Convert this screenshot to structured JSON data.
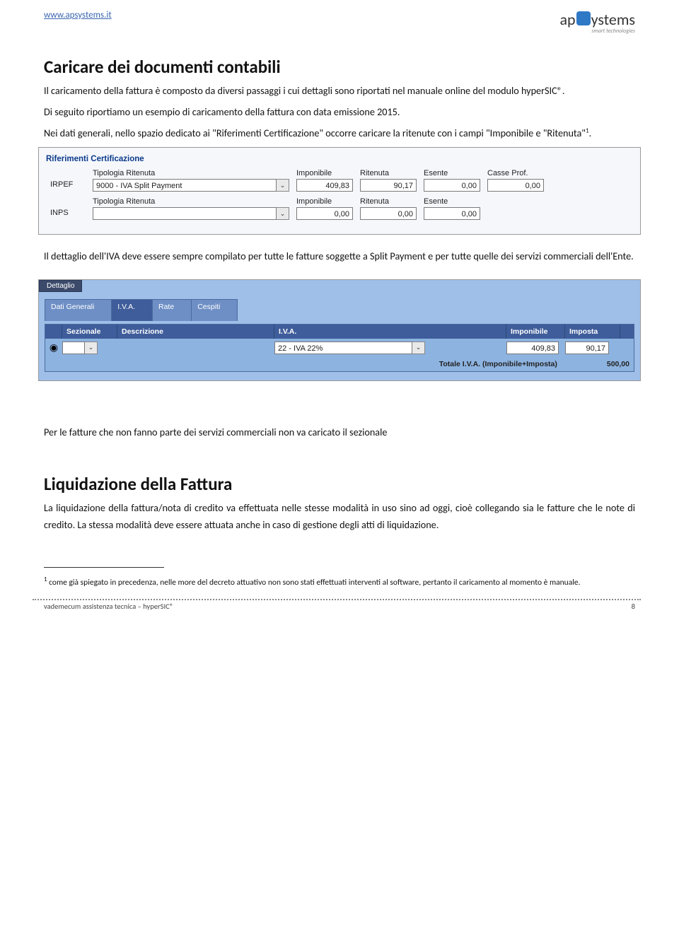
{
  "header": {
    "site_url": "www.apsystems.it",
    "logo_main": "apsystems",
    "logo_sub": "smart technologies"
  },
  "section1": {
    "title": "Caricare dei documenti contabili",
    "p1": "Il caricamento della fattura è composto da diversi passaggi i cui dettagli sono riportati nel manuale online del modulo hyperSIC®.",
    "p2": "Di seguito riportiamo un esempio di caricamento della fattura con data emissione 2015.",
    "p3a": "Nei dati generali, nello spazio dedicato ai \"Riferimenti Certificazione\" occorre caricare la ritenute con i campi \"Imponibile e \"Ritenuta\"",
    "p3sup": "1",
    "p3b": "."
  },
  "cert": {
    "group_label": "Riferimenti Certificazione",
    "irpef_label": "IRPEF",
    "inps_label": "INPS",
    "tipologia_label": "Tipologia Ritenuta",
    "imponibile_label": "Imponibile",
    "ritenuta_label": "Ritenuta",
    "esente_label": "Esente",
    "casse_label": "Casse Prof.",
    "irpef_tipologia": "9000 - IVA Split Payment",
    "irpef_imponibile": "409,83",
    "irpef_ritenuta": "90,17",
    "irpef_esente": "0,00",
    "irpef_casse": "0,00",
    "inps_tipologia": "",
    "inps_imponibile": "0,00",
    "inps_ritenuta": "0,00",
    "inps_esente": "0,00"
  },
  "section2": {
    "p1": "Il dettaglio dell'IVA deve essere sempre compilato per tutte le fatture soggette a Split Payment e per tutte quelle dei servizi commerciali dell'Ente."
  },
  "dettaglio": {
    "tab_title": "Dettaglio",
    "tabs": [
      "Dati Generali",
      "I.V.A.",
      "Rate",
      "Cespiti"
    ],
    "th_sez": "Sezionale",
    "th_desc": "Descrizione",
    "th_iva": "I.V.A.",
    "th_imp": "Imponibile",
    "th_imposta": "Imposta",
    "row_sez": "",
    "row_iva": "22 - IVA 22%",
    "row_imp": "409,83",
    "row_imposta": "90,17",
    "total_label": "Totale I.V.A. (Imponibile+Imposta)",
    "total_value": "500,00"
  },
  "section3": {
    "p1": "Per le fatture che non fanno parte dei servizi commerciali non va caricato il sezionale"
  },
  "section4": {
    "title": "Liquidazione della Fattura",
    "p1": "La liquidazione della fattura/nota di credito va effettuata nelle stesse modalità in uso sino ad oggi, cioè collegando sia le fatture che le note di credito. La stessa modalità deve essere attuata anche in caso di gestione degli atti di liquidazione."
  },
  "footnote": {
    "marker": "1",
    "text": " come già spiegato in precedenza, nelle more del decreto attuativo non sono stati effettuati interventi al software, pertanto il caricamento al momento è manuale."
  },
  "footer": {
    "left": "vademecum assistenza tecnica – hyperSIC®",
    "right": "8"
  }
}
